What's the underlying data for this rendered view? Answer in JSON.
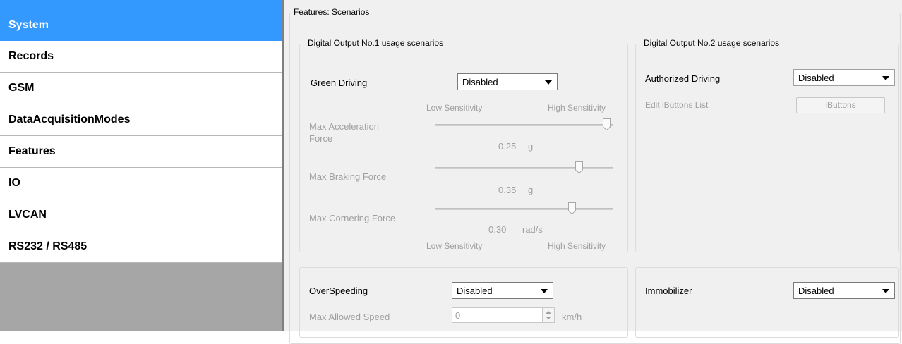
{
  "sidebar": {
    "items": [
      {
        "label": "System",
        "active": true
      },
      {
        "label": "Records"
      },
      {
        "label": "GSM"
      },
      {
        "label": "DataAcquisitionModes"
      },
      {
        "label": "Features"
      },
      {
        "label": "IO"
      },
      {
        "label": "LVCAN"
      },
      {
        "label": "RS232 / RS485"
      }
    ]
  },
  "main": {
    "title": "Features: Scenarios",
    "do1": {
      "legend": "Digital Output No.1 usage scenarios",
      "green_driving_label": "Green Driving",
      "green_driving_value": "Disabled",
      "low_sens": "Low Sensitivity",
      "high_sens": "High Sensitivity",
      "accel_label_1": "Max Acceleration",
      "accel_label_2": "Force",
      "accel_value": "0.25",
      "accel_unit": "g",
      "brake_label": "Max Braking Force",
      "brake_value": "0.35",
      "brake_unit": "g",
      "corner_label": "Max Cornering Force",
      "corner_value": "0.30",
      "corner_unit": "rad/s",
      "low_sens_bottom": "Low Sensitivity",
      "high_sens_bottom": "High Sensitivity"
    },
    "do2": {
      "legend": "Digital Output No.2 usage scenarios",
      "auth_label": "Authorized Driving",
      "auth_value": "Disabled",
      "ibuttons_label": "Edit iButtons List",
      "ibuttons_button": "iButtons"
    },
    "overspeed": {
      "label": "OverSpeeding",
      "value": "Disabled",
      "max_speed_label": "Max Allowed Speed",
      "max_speed_value": "0",
      "unit": "km/h"
    },
    "immobilizer": {
      "label": "Immobilizer",
      "value": "Disabled"
    }
  }
}
